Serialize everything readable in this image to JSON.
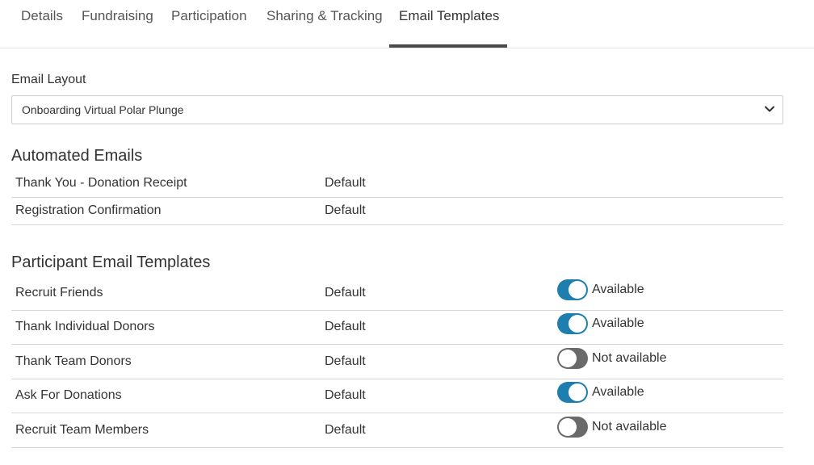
{
  "tabs": [
    {
      "label": "Details"
    },
    {
      "label": "Fundraising"
    },
    {
      "label": "Participation"
    },
    {
      "label": "Sharing & Tracking"
    },
    {
      "label": "Email Templates",
      "active": true
    }
  ],
  "email_layout": {
    "label": "Email Layout",
    "selected": "Onboarding Virtual Polar Plunge"
  },
  "automated": {
    "title": "Automated Emails",
    "rows": [
      {
        "name": "Thank You - Donation Receipt",
        "value": "Default"
      },
      {
        "name": "Registration Confirmation",
        "value": "Default"
      }
    ]
  },
  "participant": {
    "title": "Participant Email Templates",
    "rows": [
      {
        "name": "Recruit Friends",
        "value": "Default",
        "status": "Available",
        "enabled": true
      },
      {
        "name": "Thank Individual Donors",
        "value": "Default",
        "status": "Available",
        "enabled": true
      },
      {
        "name": "Thank Team Donors",
        "value": "Default",
        "status": "Not available",
        "enabled": false
      },
      {
        "name": "Ask For Donations",
        "value": "Default",
        "status": "Available",
        "enabled": true
      },
      {
        "name": "Recruit Team Members",
        "value": "Default",
        "status": "Not available",
        "enabled": false
      }
    ]
  },
  "colors": {
    "toggle_on": "#1e7fae",
    "toggle_off": "#6a6a6a",
    "tab_underline": "#4a4a4a"
  }
}
